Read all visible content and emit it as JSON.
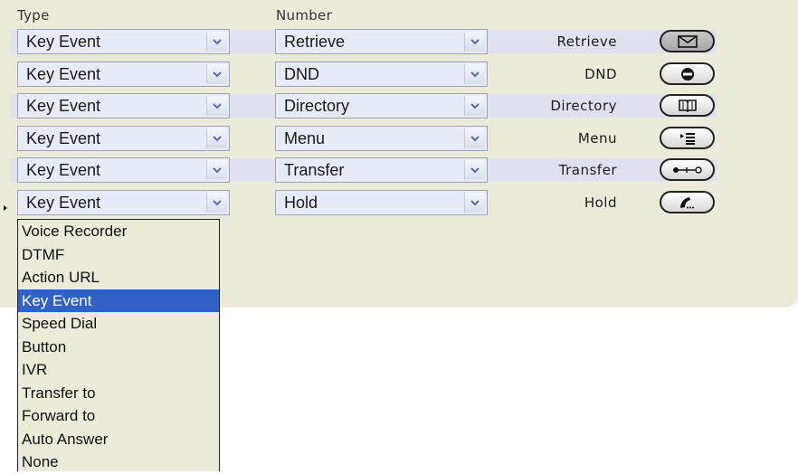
{
  "headers": {
    "type": "Type",
    "number": "Number"
  },
  "rows": [
    {
      "type": "Key Event",
      "number": "Retrieve",
      "label": "Retrieve",
      "icon": "envelope-icon"
    },
    {
      "type": "Key Event",
      "number": "DND",
      "label": "DND",
      "icon": "dnd-icon"
    },
    {
      "type": "Key Event",
      "number": "Directory",
      "label": "Directory",
      "icon": "book-icon"
    },
    {
      "type": "Key Event",
      "number": "Menu",
      "label": "Menu",
      "icon": "menu-icon"
    },
    {
      "type": "Key Event",
      "number": "Transfer",
      "label": "Transfer",
      "icon": "transfer-icon"
    },
    {
      "type": "Key Event",
      "number": "Hold",
      "label": "Hold",
      "icon": "hold-icon"
    }
  ],
  "dropdown": {
    "options": [
      "Voice Recorder",
      "DTMF",
      "Action URL",
      "Key Event",
      "Speed Dial",
      "Button",
      "IVR",
      "Transfer to",
      "Forward to",
      "Auto Answer",
      "None"
    ],
    "selected": "Key Event"
  },
  "colors": {
    "panel": "#ecead9",
    "row_band": "#dfe1ef",
    "select_bg": "#e6ebf7",
    "highlight": "#3160c6"
  }
}
